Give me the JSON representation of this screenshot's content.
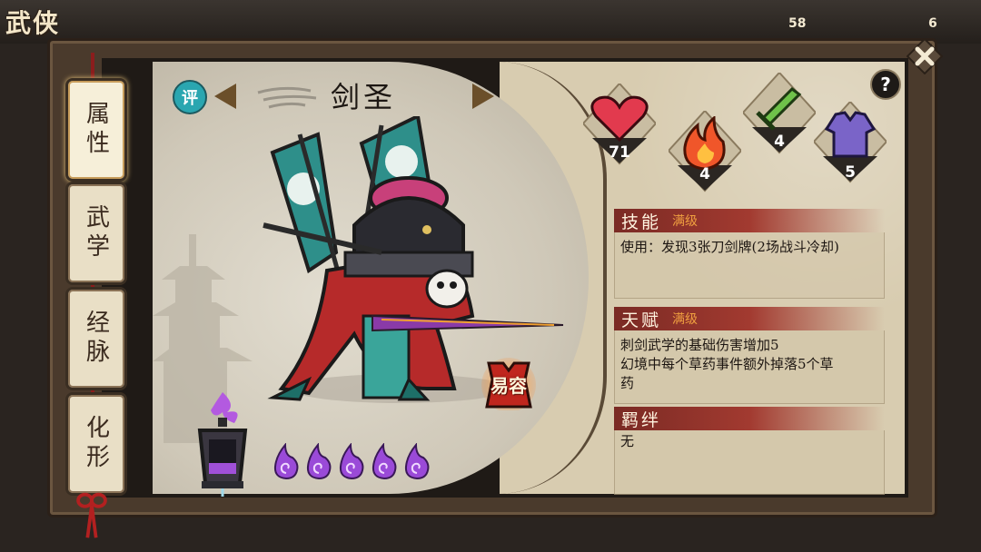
{
  "top_bar": {
    "game_title": "武侠",
    "stat_1": "58",
    "stat_2": "6"
  },
  "tabs": [
    {
      "label": "属性",
      "active": true
    },
    {
      "label": "武学",
      "active": false
    },
    {
      "label": "经脉",
      "active": false
    },
    {
      "label": "化形",
      "active": false
    }
  ],
  "header": {
    "ping_icon_label": "评",
    "character_name": "剑圣"
  },
  "stats": [
    {
      "name": "heart",
      "value": "71",
      "color": "#e23a4e"
    },
    {
      "name": "fire",
      "value": "4",
      "color": "#f0562a"
    },
    {
      "name": "sword",
      "value": "4",
      "color": "#6fc24a"
    },
    {
      "name": "armor",
      "value": "5",
      "color": "#7a64c8"
    }
  ],
  "disguise": {
    "label": "易容"
  },
  "spirit_flames": {
    "count": 5,
    "color": "#9a4ad8"
  },
  "sections": {
    "skill": {
      "title": "技能",
      "badge": "满级",
      "text": "使用：发现3张刀剑牌(2场战斗冷却)"
    },
    "talent": {
      "title": "天赋",
      "badge": "满级",
      "lines": [
        "刺剑武学的基础伤害增加5",
        "幻境中每个草药事件额外掉落5个草",
        "药"
      ]
    },
    "bond": {
      "title": "羁绊",
      "text": "无"
    }
  },
  "help": {
    "label": "?"
  }
}
